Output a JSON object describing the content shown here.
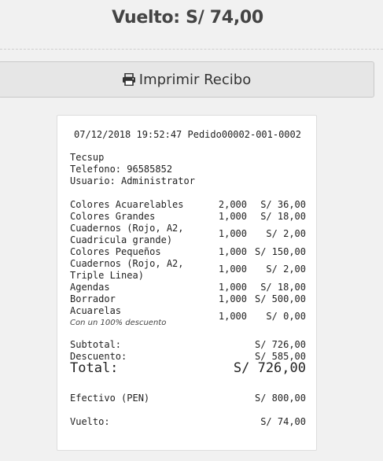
{
  "change": {
    "title": "Vuelto: S/ 74,00"
  },
  "print_button": {
    "label": "Imprimir Recibo",
    "icon": "print-icon"
  },
  "receipt": {
    "header": "07/12/2018 19:52:47 Pedido00002-001-0002",
    "store": "Tecsup",
    "phone": "Telefono: 96585852",
    "user": "Usuario: Administrator",
    "items": [
      {
        "name": "Colores Acuarelables",
        "qty": "2,000",
        "amount": "S/ 36,00"
      },
      {
        "name": "Colores Grandes",
        "qty": "1,000",
        "amount": "S/ 18,00"
      },
      {
        "name": "Cuadernos (Rojo, A2,",
        "name2": "Cuadricula grande)",
        "qty": "1,000",
        "amount": "S/ 2,00"
      },
      {
        "name": "Colores Pequeños",
        "qty": "1,000",
        "amount": "S/ 150,00"
      },
      {
        "name": "Cuadernos (Rojo, A2,",
        "name2": "Triple Linea)",
        "qty": "1,000",
        "amount": "S/ 2,00"
      },
      {
        "name": "Agendas",
        "qty": "1,000",
        "amount": "S/ 18,00"
      },
      {
        "name": "Borrador",
        "qty": "1,000",
        "amount": "S/ 500,00"
      },
      {
        "name": "Acuarelas",
        "note": "Con un 100% descuento",
        "qty": "1,000",
        "amount": "S/ 0,00"
      }
    ],
    "subtotal_label": "Subtotal:",
    "subtotal": "S/ 726,00",
    "discount_label": "Descuento:",
    "discount": "S/ 585,00",
    "total_label": "Total:",
    "total": "S/ 726,00",
    "cash_label": "Efectivo (PEN)",
    "cash": "S/ 800,00",
    "change_label": "Vuelto:",
    "change": "S/ 74,00"
  }
}
